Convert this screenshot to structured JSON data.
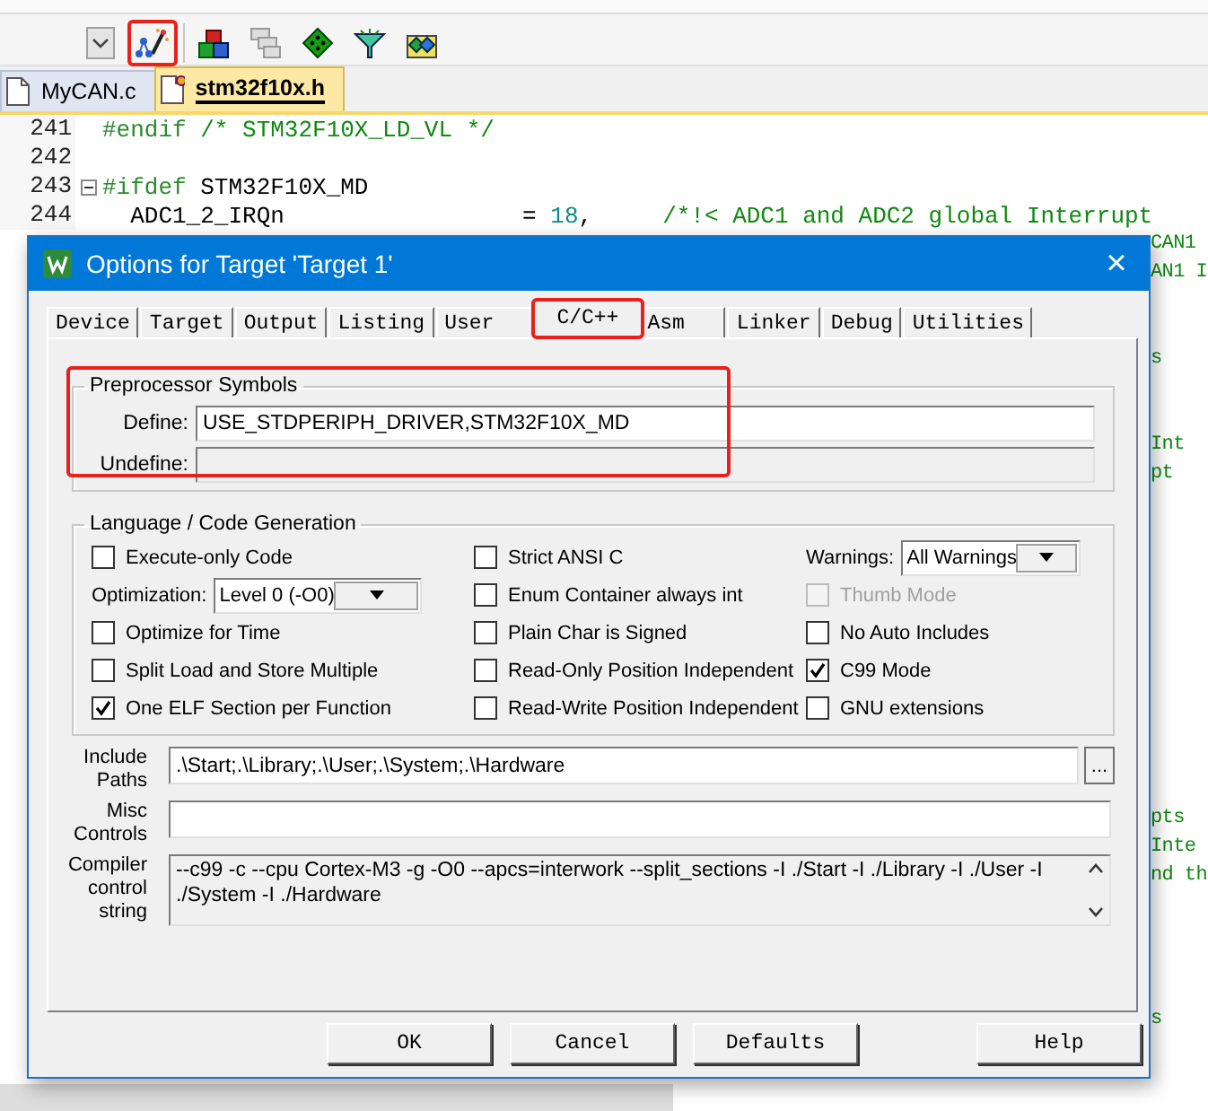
{
  "toolbar": [
    {
      "kind": "dropdown",
      "annotated": false
    },
    {
      "kind": "wand",
      "annotated": true
    },
    {
      "kind": "pack",
      "annotated": false
    },
    {
      "kind": "stack",
      "annotated": false
    },
    {
      "kind": "diamond",
      "annotated": false
    },
    {
      "kind": "funnel",
      "annotated": false
    },
    {
      "kind": "multi",
      "annotated": false
    }
  ],
  "file_tabs": [
    {
      "label": "MyCAN.c",
      "selected": false
    },
    {
      "label": "stm32f10x.h",
      "selected": true
    }
  ],
  "editor": {
    "lines": [
      {
        "kind": "code",
        "number": "241",
        "segments": [
          {
            "kind": "directive",
            "text": "#endif"
          },
          {
            "kind": "comment",
            "text": " /* STM32F10X_LD_VL */"
          }
        ]
      },
      {
        "kind": "code",
        "number": "242"
      },
      {
        "kind": "code",
        "number": "243",
        "fold": true,
        "segments": [
          {
            "kind": "directive",
            "text": "#ifdef"
          },
          {
            "kind": "plain",
            "text": " STM32F10X_MD"
          }
        ]
      },
      {
        "kind": "code",
        "number": "244",
        "segments": [
          {
            "kind": "plain",
            "text": "  ADC1_2_IRQn                 = "
          },
          {
            "kind": "number",
            "text": "18"
          },
          {
            "kind": "plain",
            "text": ",     "
          },
          {
            "kind": "comment",
            "text": "/*!< ADC1 and ADC2 global Interrupt"
          }
        ]
      },
      {
        "kind": "tail",
        "text": "CAN1"
      },
      {
        "kind": "tail",
        "text": "AN1 I"
      },
      {
        "kind": "hidden"
      },
      {
        "kind": "hidden"
      },
      {
        "kind": "tail",
        "text": "s"
      },
      {
        "kind": "hidden"
      },
      {
        "kind": "hidden"
      },
      {
        "kind": "tail",
        "text": "Int"
      },
      {
        "kind": "tail",
        "text": "pt"
      },
      {
        "kind": "hidden"
      },
      {
        "kind": "hidden"
      },
      {
        "kind": "hidden"
      },
      {
        "kind": "hidden"
      },
      {
        "kind": "hidden"
      },
      {
        "kind": "hidden"
      },
      {
        "kind": "hidden"
      },
      {
        "kind": "hidden"
      },
      {
        "kind": "hidden"
      },
      {
        "kind": "hidden"
      },
      {
        "kind": "hidden"
      },
      {
        "kind": "tail",
        "text": "pts"
      },
      {
        "kind": "tail",
        "text": "Inte"
      },
      {
        "kind": "tail",
        "text": "nd th"
      },
      {
        "kind": "hidden"
      },
      {
        "kind": "hidden"
      },
      {
        "kind": "hidden"
      },
      {
        "kind": "hidden"
      },
      {
        "kind": "tail",
        "text": "s"
      }
    ]
  },
  "dialog": {
    "title": "Options for Target 'Target 1'",
    "close": "×",
    "tabs": [
      {
        "label": "Device",
        "selected": false,
        "annotated": false
      },
      {
        "label": "Target",
        "selected": false,
        "annotated": false
      },
      {
        "label": "Output",
        "selected": false,
        "annotated": false
      },
      {
        "label": "Listing",
        "selected": false,
        "annotated": false
      },
      {
        "label": "User",
        "selected": false,
        "annotated": false
      },
      {
        "label": "C/C++",
        "selected": true,
        "annotated": true
      },
      {
        "label": "Asm",
        "selected": false,
        "annotated": false
      },
      {
        "label": "Linker",
        "selected": false,
        "annotated": false
      },
      {
        "label": "Debug",
        "selected": false,
        "annotated": false
      },
      {
        "label": "Utilities",
        "selected": false,
        "annotated": false
      }
    ],
    "preprocessor": {
      "title": "Preprocessor Symbols",
      "annotated": true,
      "define": {
        "label": "Define:",
        "value": "USE_STDPERIPH_DRIVER,STM32F10X_MD",
        "disabled": false
      },
      "undefine": {
        "label": "Undefine:",
        "disabled": true
      }
    },
    "language": {
      "title": "Language / Code Generation",
      "columns": [
        [
          {
            "kind": "checkbox",
            "label": "Execute-only Code",
            "checked": false,
            "disabled": false
          },
          {
            "kind": "select",
            "label": "Optimization:",
            "value": "Level 0 (-O0)"
          },
          {
            "kind": "checkbox",
            "label": "Optimize for Time",
            "checked": false,
            "disabled": false
          },
          {
            "kind": "checkbox",
            "label": "Split Load and Store Multiple",
            "checked": false,
            "disabled": false
          },
          {
            "kind": "checkbox",
            "label": "One ELF Section per Function",
            "checked": true,
            "disabled": false
          }
        ],
        [
          {
            "kind": "checkbox",
            "label": "Strict ANSI C",
            "checked": false,
            "disabled": false
          },
          {
            "kind": "checkbox",
            "label": "Enum Container always int",
            "checked": false,
            "disabled": false
          },
          {
            "kind": "checkbox",
            "label": "Plain Char is Signed",
            "checked": false,
            "disabled": false
          },
          {
            "kind": "checkbox",
            "label": "Read-Only Position Independent",
            "checked": false,
            "disabled": false
          },
          {
            "kind": "checkbox",
            "label": "Read-Write Position Independent",
            "checked": false,
            "disabled": false
          }
        ],
        [
          {
            "kind": "select",
            "label": "Warnings:",
            "value": "All Warnings"
          },
          {
            "kind": "checkbox",
            "label": "Thumb Mode",
            "checked": false,
            "disabled": true
          },
          {
            "kind": "checkbox",
            "label": "No Auto Includes",
            "checked": false,
            "disabled": false
          },
          {
            "kind": "checkbox",
            "label": "C99 Mode",
            "checked": true,
            "disabled": false
          },
          {
            "kind": "checkbox",
            "label": "GNU extensions",
            "checked": false,
            "disabled": false
          }
        ]
      ]
    },
    "fields": [
      {
        "kind": "path",
        "label": "Include Paths",
        "value": ".\\Start;.\\Library;.\\User;.\\System;.\\Hardware",
        "browse": "..."
      },
      {
        "kind": "text",
        "label": "Misc Controls"
      },
      {
        "kind": "readonly",
        "label": "Compiler control string",
        "value": "--c99 -c --cpu Cortex-M3 -g -O0 --apcs=interwork --split_sections -I ./Start -I ./Library -I ./User -I ./System -I ./Hardware"
      }
    ],
    "buttons": [
      "OK",
      "Cancel",
      "Defaults",
      "Help"
    ]
  }
}
